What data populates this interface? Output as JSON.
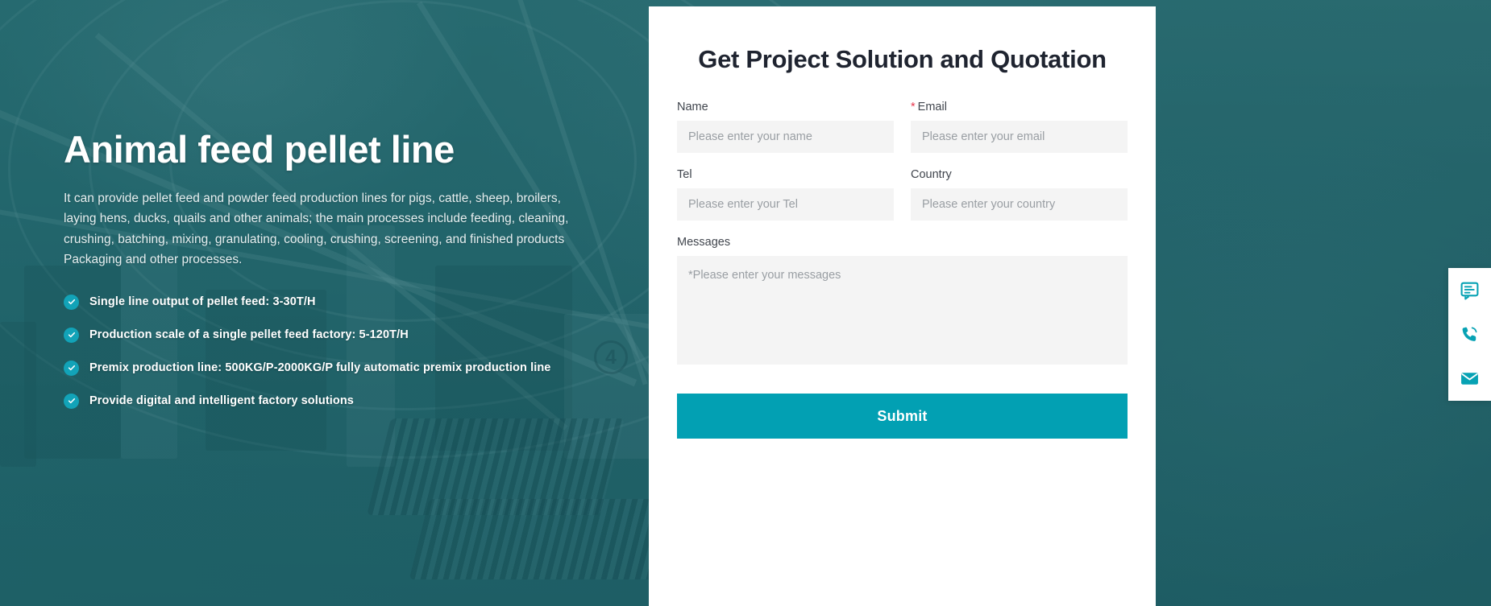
{
  "hero": {
    "title": "Animal feed pellet line",
    "description": "It can provide pellet feed and powder feed production lines for pigs, cattle, sheep, broilers, laying hens, ducks, quails and other animals; the main processes include feeding, cleaning, crushing, batching, mixing, granulating, cooling, crushing, screening, and finished products Packaging and other processes.",
    "features": [
      {
        "text": "Single line output of pellet feed: 3-30T/H"
      },
      {
        "text": "Production scale of a single pellet feed factory: 5-120T/H"
      },
      {
        "text": "Premix production line: 500KG/P-2000KG/P fully automatic premix production line"
      },
      {
        "text": "Provide digital and intelligent factory solutions"
      }
    ],
    "background_badge": "4"
  },
  "form": {
    "title": "Get Project Solution and Quotation",
    "fields": {
      "name": {
        "label": "Name",
        "placeholder": "Please enter your name",
        "value": "",
        "required": false
      },
      "email": {
        "label": "Email",
        "required_mark": "*",
        "placeholder": "Please enter your email",
        "value": "",
        "required": true
      },
      "tel": {
        "label": "Tel",
        "placeholder": "Please enter your Tel",
        "value": "",
        "required": false
      },
      "country": {
        "label": "Country",
        "placeholder": "Please enter your country",
        "value": "",
        "required": false
      },
      "messages": {
        "label": "Messages",
        "placeholder": "*Please enter your messages",
        "value": "",
        "required": true
      }
    },
    "submit_label": "Submit"
  },
  "side_dock": {
    "buttons": [
      {
        "icon": "message-list-icon",
        "name": "inquiry-button"
      },
      {
        "icon": "phone-icon",
        "name": "phone-button"
      },
      {
        "icon": "email-icon",
        "name": "email-button"
      }
    ]
  },
  "colors": {
    "accent": "#02a0b3",
    "check_badge": "#12a3b8",
    "hero_overlay": "#1a6067",
    "required_star": "#e8384f",
    "input_bg": "#f4f4f4",
    "title_text": "#1f2430"
  }
}
